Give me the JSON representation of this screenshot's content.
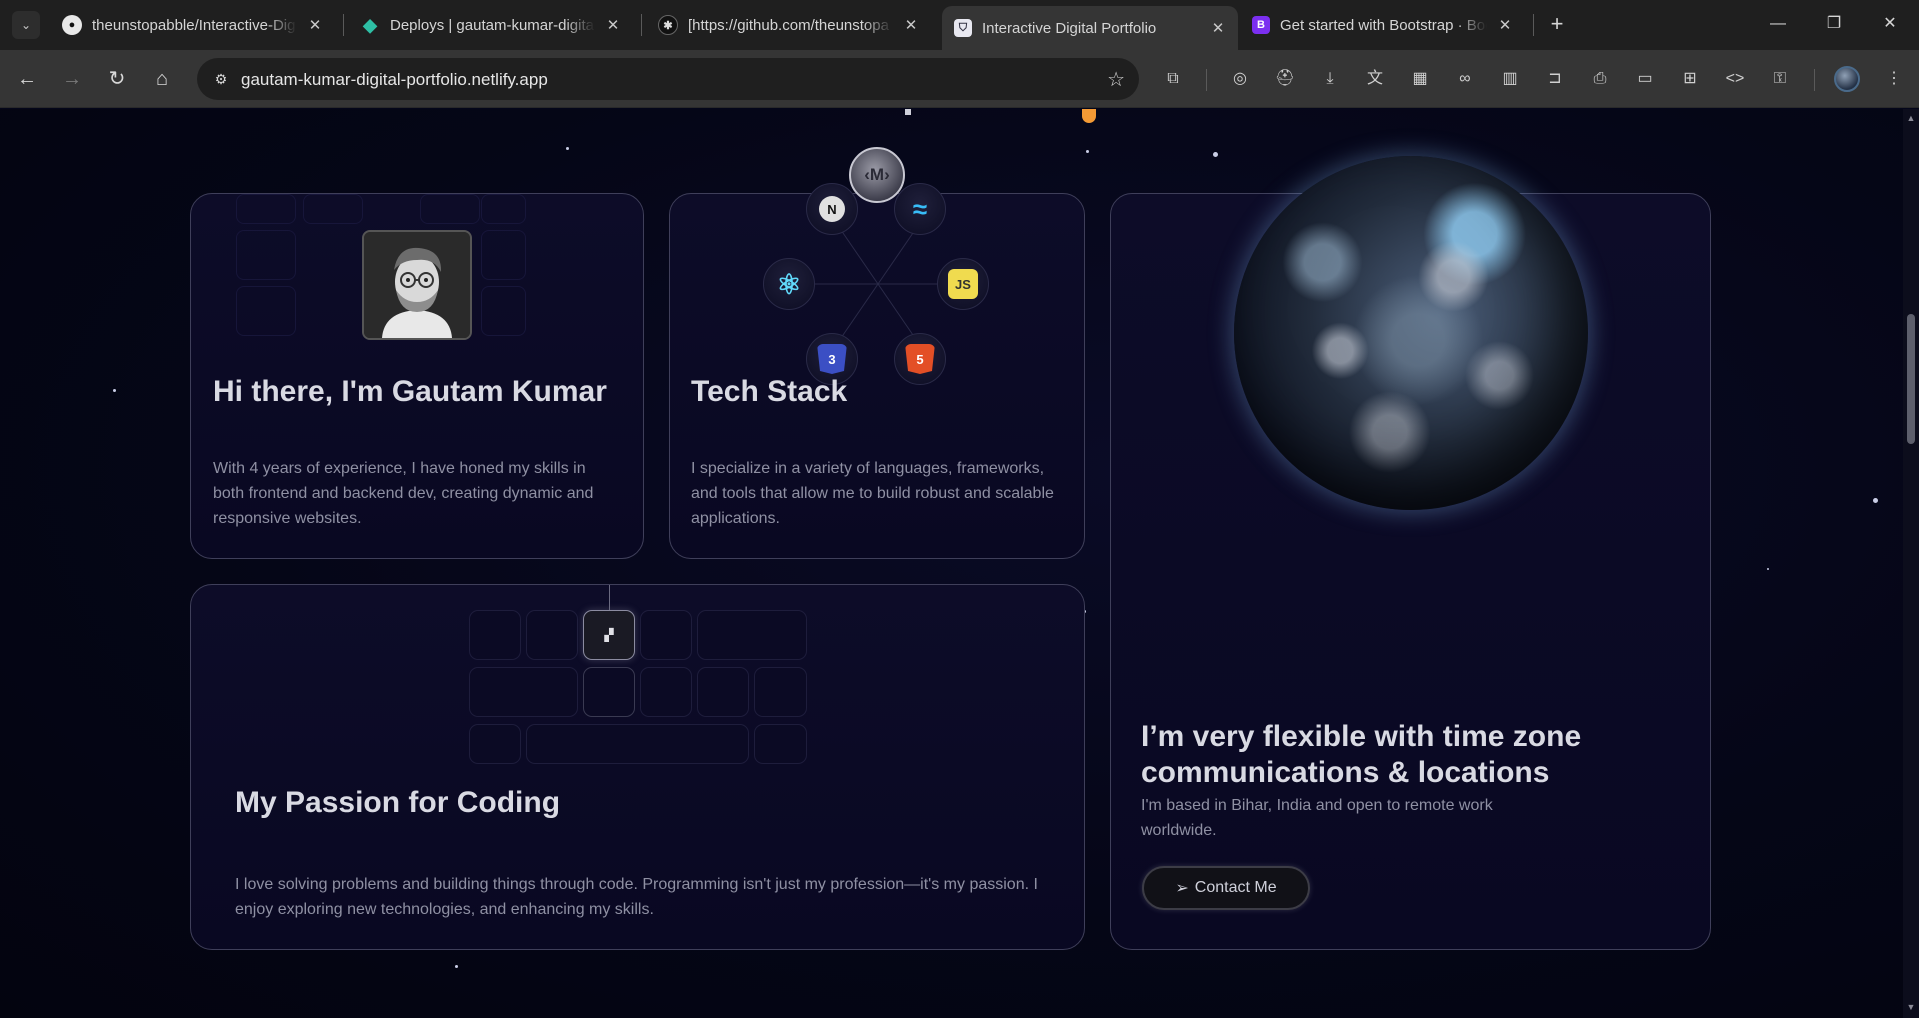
{
  "browser": {
    "tabs": [
      {
        "title": "theunstopabble/Interactive-Dig",
        "icon": "github-icon"
      },
      {
        "title": "Deploys | gautam-kumar-digita",
        "icon": "netlify-icon"
      },
      {
        "title": "[https://github.com/theunstopa",
        "icon": "site-icon"
      },
      {
        "title": "Interactive Digital Portfolio",
        "icon": "shield-icon",
        "active": true
      },
      {
        "title": "Get started with Bootstrap · Boo",
        "icon": "bootstrap-icon"
      }
    ],
    "new_tab": "+",
    "url": "gautam-kumar-digital-portfolio.netlify.app"
  },
  "cards": {
    "intro": {
      "title": "Hi there, I'm Gautam Kumar",
      "description": "With 4 years of experience, I have honed my skills in both frontend and backend dev, creating dynamic and responsive websites."
    },
    "tech": {
      "title": "Tech Stack",
      "description": "I specialize in a variety of languages, frameworks, and tools that allow me to build robust and scalable applications.",
      "center_logo": "‹M›",
      "icons": {
        "next": "N",
        "tailwind": "≈",
        "react": "⚛",
        "js": "JS",
        "css": "3",
        "html": "5"
      }
    },
    "passion": {
      "title": "My Passion for Coding",
      "description": "I love solving problems and building things through code. Programming isn't just my profession—it's my passion. I enjoy exploring new technologies, and enhancing my skills."
    },
    "location": {
      "title": "I’m very flexible with time zone communications & locations",
      "description": "I'm based in Bihar, India and open to remote work worldwide.",
      "button": "Contact Me",
      "button_icon": "➢"
    }
  },
  "colors": {
    "accent_orange": "#f39a35",
    "card_border": "#3f3f5a",
    "page_bg": "#04061a"
  }
}
